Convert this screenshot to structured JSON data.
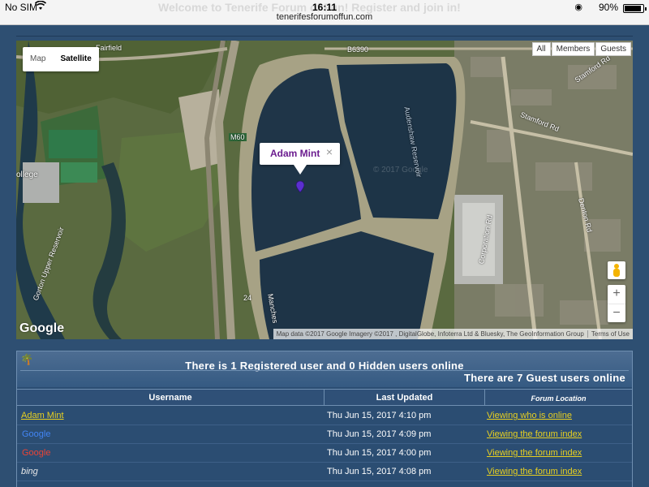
{
  "status_bar": {
    "carrier": "No SIM",
    "time": "16:11",
    "url": "tenerifesforumoffun.com",
    "battery": "90%",
    "background_banner": "Welcome to Tenerife Forum of Fun! Register and join in!"
  },
  "map": {
    "type_buttons": [
      "Map",
      "Satellite"
    ],
    "active_type": "Satellite",
    "filters": [
      "All",
      "Members",
      "Guests"
    ],
    "info_window": {
      "name": "Adam Mint",
      "close": "×"
    },
    "zoom_in": "+",
    "zoom_out": "−",
    "logo": "Google",
    "attribution": "Map data ©2017 Google Imagery ©2017 , DigitalGlobe, Infoterra Ltd & Bluesky, The GeoInformation Group",
    "terms": "Terms of Use",
    "watermark": "© 2017 Google",
    "labels": {
      "fairfield": "Fairfield",
      "road_b6390": "B6390",
      "stamford_rd": "Stamford Rd",
      "stamford_rd_2": "Stamford Rd",
      "m60": "M60",
      "audenshaw": "Audenshaw Reservoir",
      "college": "ollege",
      "corporation_rd": "Corporation Rd",
      "denton_rd": "Denton Rd",
      "gorton": "Gorton Upper Reservoir",
      "manchester": "Manches",
      "road_24": "24"
    }
  },
  "online": {
    "registered_line": "There is 1 Registered user and 0 Hidden users online",
    "guest_line": "There are 7 Guest users online",
    "columns": [
      "Username",
      "Last Updated",
      "Forum Location"
    ],
    "rows": [
      {
        "user": "Adam Mint",
        "updated": "Thu Jun 15, 2017 4:10 pm",
        "location": "Viewing who is online"
      },
      {
        "user": "Google",
        "updated": "Thu Jun 15, 2017 4:09 pm",
        "location": "Viewing the forum index"
      },
      {
        "user": "Google",
        "updated": "Thu Jun 15, 2017 4:00 pm",
        "location": "Viewing the forum index"
      },
      {
        "user": "bing",
        "updated": "Thu Jun 15, 2017 4:08 pm",
        "location": "Viewing the forum index"
      }
    ]
  },
  "colors": {
    "page_bg": "#2e4f72",
    "link_yellow": "#e8d020",
    "info_name_purple": "#6b1c8f",
    "marker_purple": "#5b2fd0"
  }
}
